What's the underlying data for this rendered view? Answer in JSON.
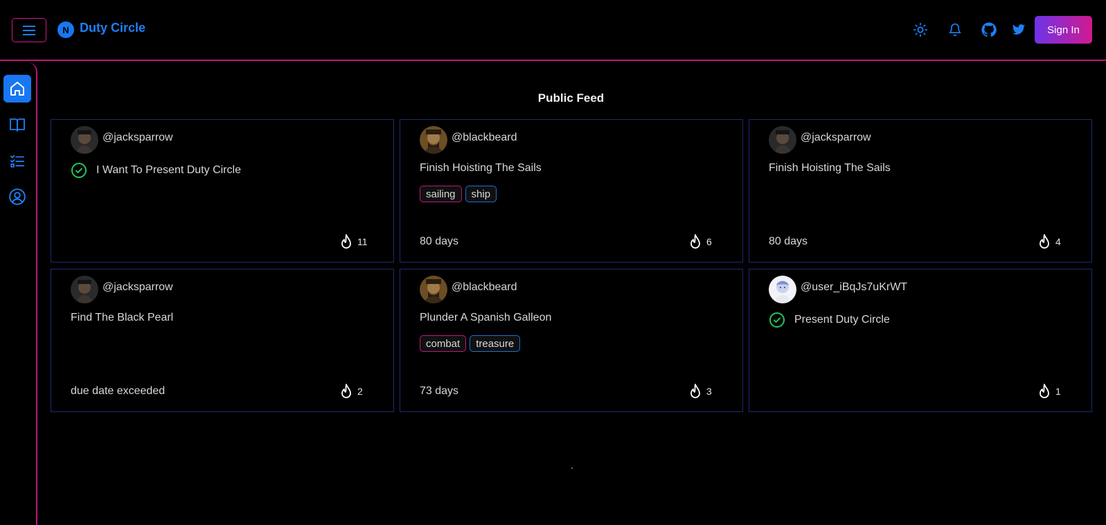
{
  "header": {
    "app_title": "Duty Circle",
    "logo_letter": "N",
    "sign_in_label": "Sign In",
    "icons": [
      "menu-icon",
      "sun-icon",
      "bell-icon",
      "github-icon",
      "twitter-icon"
    ]
  },
  "sidebar": {
    "items": [
      {
        "icon": "home-icon",
        "active": true
      },
      {
        "icon": "book-icon",
        "active": false
      },
      {
        "icon": "checklist-icon",
        "active": false
      },
      {
        "icon": "user-circle-icon",
        "active": false
      }
    ]
  },
  "main": {
    "title": "Public Feed",
    "cards": [
      {
        "handle": "@jacksparrow",
        "task": "I Want To Present Duty Circle",
        "completed": true,
        "tags": [],
        "due": "",
        "likes": "11"
      },
      {
        "handle": "@blackbeard",
        "task": "Finish Hoisting The Sails",
        "completed": false,
        "tags": [
          "sailing",
          "ship"
        ],
        "due": "80 days",
        "likes": "6"
      },
      {
        "handle": "@jacksparrow",
        "task": "Finish Hoisting The Sails",
        "completed": false,
        "tags": [],
        "due": "80 days",
        "likes": "4"
      },
      {
        "handle": "@jacksparrow",
        "task": "Find The Black Pearl",
        "completed": false,
        "tags": [],
        "due": "due date exceeded",
        "likes": "2"
      },
      {
        "handle": "@blackbeard",
        "task": "Plunder A Spanish Galleon",
        "completed": false,
        "tags": [
          "combat",
          "treasure"
        ],
        "due": "73 days",
        "likes": "3"
      },
      {
        "handle": "@user_iBqJs7uKrWT",
        "task": "Present Duty Circle",
        "completed": true,
        "tags": [],
        "due": "",
        "likes": "1"
      }
    ]
  },
  "colors": {
    "accent_blue": "#1877f2",
    "accent_pink": "#c0157f",
    "card_border": "#1d2a6e",
    "check_green": "#22c55e"
  }
}
